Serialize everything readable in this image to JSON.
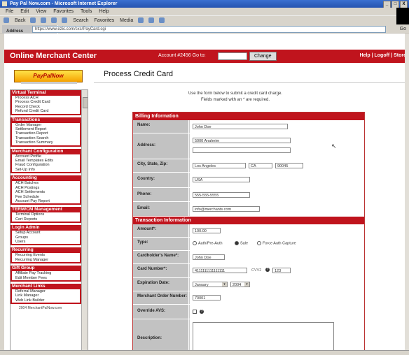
{
  "browser": {
    "title": "Pay Pal Now.com - Microsoft Internet Explorer",
    "menu": [
      "File",
      "Edit",
      "View",
      "Favorites",
      "Tools",
      "Help"
    ],
    "toolbar": [
      "Back",
      "Search",
      "Favorites",
      "Media"
    ],
    "address_label": "Address",
    "address_value": "https://www.ezic.com/cxc/PayCard.cgi",
    "go_label": "Go",
    "win_buttons": [
      "_",
      "□",
      "X"
    ]
  },
  "header": {
    "brand": "Online Merchant Center",
    "account_label": "Account #2456 Go to:",
    "change_button": "Change",
    "links": "Help | Logoff | Store"
  },
  "logo": {
    "text": "PayPalNow"
  },
  "sidebar": {
    "sections": [
      {
        "title": "Virtual Terminal",
        "items": [
          "Process ACH",
          "Process Credit Card",
          "Record Check",
          "Refund Credit Card"
        ]
      },
      {
        "title": "Transactions",
        "items": [
          "Order Manager",
          "Settlement Report",
          "Transaction Report",
          "Transaction Search",
          "Transaction Summary"
        ]
      },
      {
        "title": "Merchant Configuration",
        "items": [
          "Account Profile",
          "Email Templates Edits",
          "Fraud Configuration",
          "Set-Up Info"
        ]
      },
      {
        "title": "Accounting",
        "items": [
          "ACH Batches",
          "ACH Postings",
          "ACH Settlements",
          "Fee Schedule",
          "Account Pay Report"
        ]
      },
      {
        "title": "TERM/CM Management",
        "items": [
          "Terminal Options",
          "Cert Reports"
        ]
      },
      {
        "title": "Login Admin",
        "items": [
          "Setup Account",
          "Groups",
          "Users"
        ]
      },
      {
        "title": "Recurring",
        "items": [
          "Recurring Events",
          "Recurring Manager"
        ]
      },
      {
        "title": "Gift Group",
        "items": [
          "Affiliate Pay Tracking",
          "Edit Member Fees"
        ]
      },
      {
        "title": "Merchant Links",
        "items": [
          "Referral Manager",
          "Link Manager",
          "Web Link Builder"
        ]
      }
    ],
    "copyright": "2004 MerchantPalNow.com"
  },
  "main": {
    "title": "Process Credit Card",
    "intro_line1": "Use the form below to submit a credit card charge.",
    "intro_line2": "Fields marked with an * are required."
  },
  "billing": {
    "header": "Billing Information",
    "name_label": "Name:",
    "name_value": "John Doe",
    "address_label": "Address:",
    "address_value": "5000 Anaheim",
    "city_label": "City, State, Zip:",
    "city_value": "Los Angeles",
    "state_value": "CA",
    "zip_value": "90045",
    "country_label": "Country:",
    "country_value": "USA",
    "phone_label": "Phone:",
    "phone_value": "555-555-5555",
    "email_label": "Email:",
    "email_value": "info@merchants.com"
  },
  "transaction": {
    "header": "Transaction Information",
    "amount_label": "Amount*:",
    "amount_value": "100.00",
    "type_label": "Type:",
    "type_options": [
      "Auth/Pre-Auth",
      "Sale",
      "Force Auth Capture"
    ],
    "type_selected": "Sale",
    "holder_label": "Cardholder's Name*:",
    "holder_value": "John Doe",
    "card_label": "Card Number*:",
    "card_value": "4111111111111111",
    "cvv_label": "CVV2",
    "cvv_value": "123",
    "exp_label": "Expiration Date:",
    "exp_month": "January",
    "exp_year": "2004",
    "invoice_label": "Merchant Order Number:",
    "invoice_value": "70001",
    "override_label": "Override AVS:",
    "desc_label": "Description:"
  }
}
